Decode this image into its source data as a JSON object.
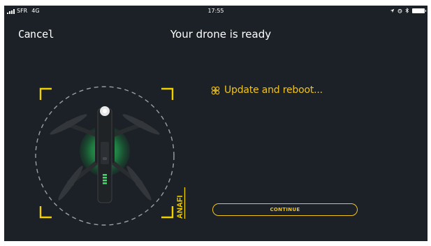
{
  "status_bar": {
    "carrier": "SFR",
    "network": "4G",
    "time": "17:55",
    "icons": [
      "signal-bars-icon",
      "location-arrow-icon",
      "alarm-clock-icon",
      "bluetooth-icon",
      "battery-icon"
    ]
  },
  "nav": {
    "cancel_label": "Cancel",
    "title": "Your drone is ready"
  },
  "status": {
    "icon": "propeller-icon",
    "message": "Update and reboot..."
  },
  "drone": {
    "model_label": "ANAFI"
  },
  "actions": {
    "continue_label": "CONTINUE"
  },
  "colors": {
    "background": "#1b2127",
    "accent": "#f2c31c",
    "text": "#ffffff",
    "status_led": "#3ddc64"
  }
}
